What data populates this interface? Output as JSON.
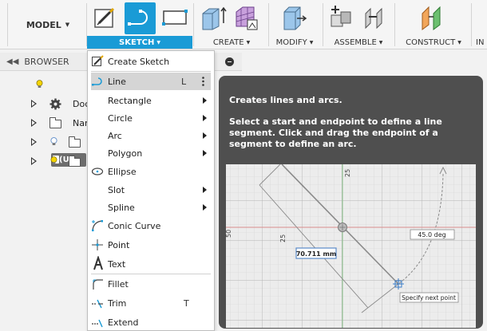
{
  "toolbar": {
    "model_label": "MODEL",
    "sections": {
      "sketch": "SKETCH",
      "create": "CREATE",
      "modify": "MODIFY",
      "assemble": "ASSEMBLE",
      "construct": "CONSTRUCT",
      "inspect": "IN"
    },
    "accent": "#1a9bd6"
  },
  "browser": {
    "title": "BROWSER",
    "rows": [
      {
        "text": "(U"
      },
      {
        "text": "Doc"
      },
      {
        "text": "Nam"
      },
      {
        "text": ""
      },
      {
        "text": ""
      }
    ]
  },
  "sketch_menu": {
    "items": [
      {
        "label": "Create Sketch",
        "icon": "create-sketch-icon"
      },
      {
        "label": "Line",
        "icon": "line-icon",
        "shortcut": "L",
        "active": true
      },
      {
        "label": "Rectangle",
        "submenu": true
      },
      {
        "label": "Circle",
        "submenu": true
      },
      {
        "label": "Arc",
        "submenu": true
      },
      {
        "label": "Polygon",
        "submenu": true
      },
      {
        "label": "Ellipse",
        "icon": "ellipse-icon"
      },
      {
        "label": "Slot",
        "submenu": true
      },
      {
        "label": "Spline",
        "submenu": true
      },
      {
        "label": "Conic Curve",
        "icon": "conic-curve-icon"
      },
      {
        "label": "Point",
        "icon": "point-icon"
      },
      {
        "label": "Text",
        "icon": "text-icon"
      },
      {
        "label": "Fillet",
        "icon": "fillet-icon"
      },
      {
        "label": "Trim",
        "icon": "trim-icon",
        "shortcut": "T"
      },
      {
        "label": "Extend",
        "icon": "extend-icon"
      }
    ]
  },
  "tooltip": {
    "title": "Creates lines and arcs.",
    "description": "Select a start and endpoint to define a line segment. Click and drag the endpoint of a segment to define an arc.",
    "illustration": {
      "length_label": "70.711 mm",
      "angle_label": "45.0 deg",
      "dim_top": "25",
      "dim_left": "25",
      "dim_edge": "50",
      "prompt": "Specify next point"
    }
  }
}
